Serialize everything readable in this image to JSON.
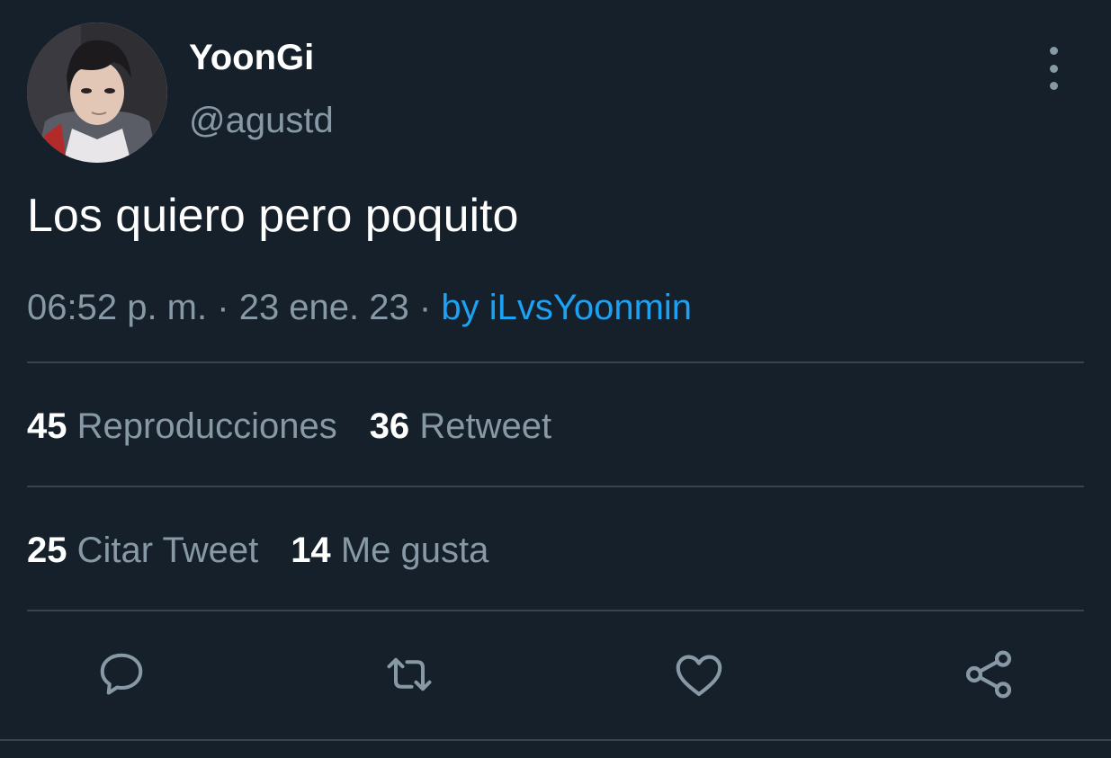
{
  "tweet": {
    "author_name": "YoonGi",
    "author_handle": "@agustd",
    "text": "Los quiero pero poquito",
    "time": "06:52 p. m.",
    "separator": "·",
    "date": "23 ene. 23",
    "source": "by iLvsYoonmin"
  },
  "stats": {
    "views_count": "45",
    "views_label": "Reproducciones",
    "retweets_count": "36",
    "retweets_label": "Retweet",
    "quotes_count": "25",
    "quotes_label": "Citar Tweet",
    "likes_count": "14",
    "likes_label": "Me gusta"
  },
  "actions": [
    {
      "icon": "reply-icon"
    },
    {
      "icon": "retweet-icon"
    },
    {
      "icon": "like-icon"
    },
    {
      "icon": "share-icon"
    }
  ],
  "colors": {
    "background": "#15202b",
    "primary_text": "#ffffff",
    "secondary_text": "#8899a6",
    "accent": "#1da1f2",
    "divider": "#38444d"
  }
}
